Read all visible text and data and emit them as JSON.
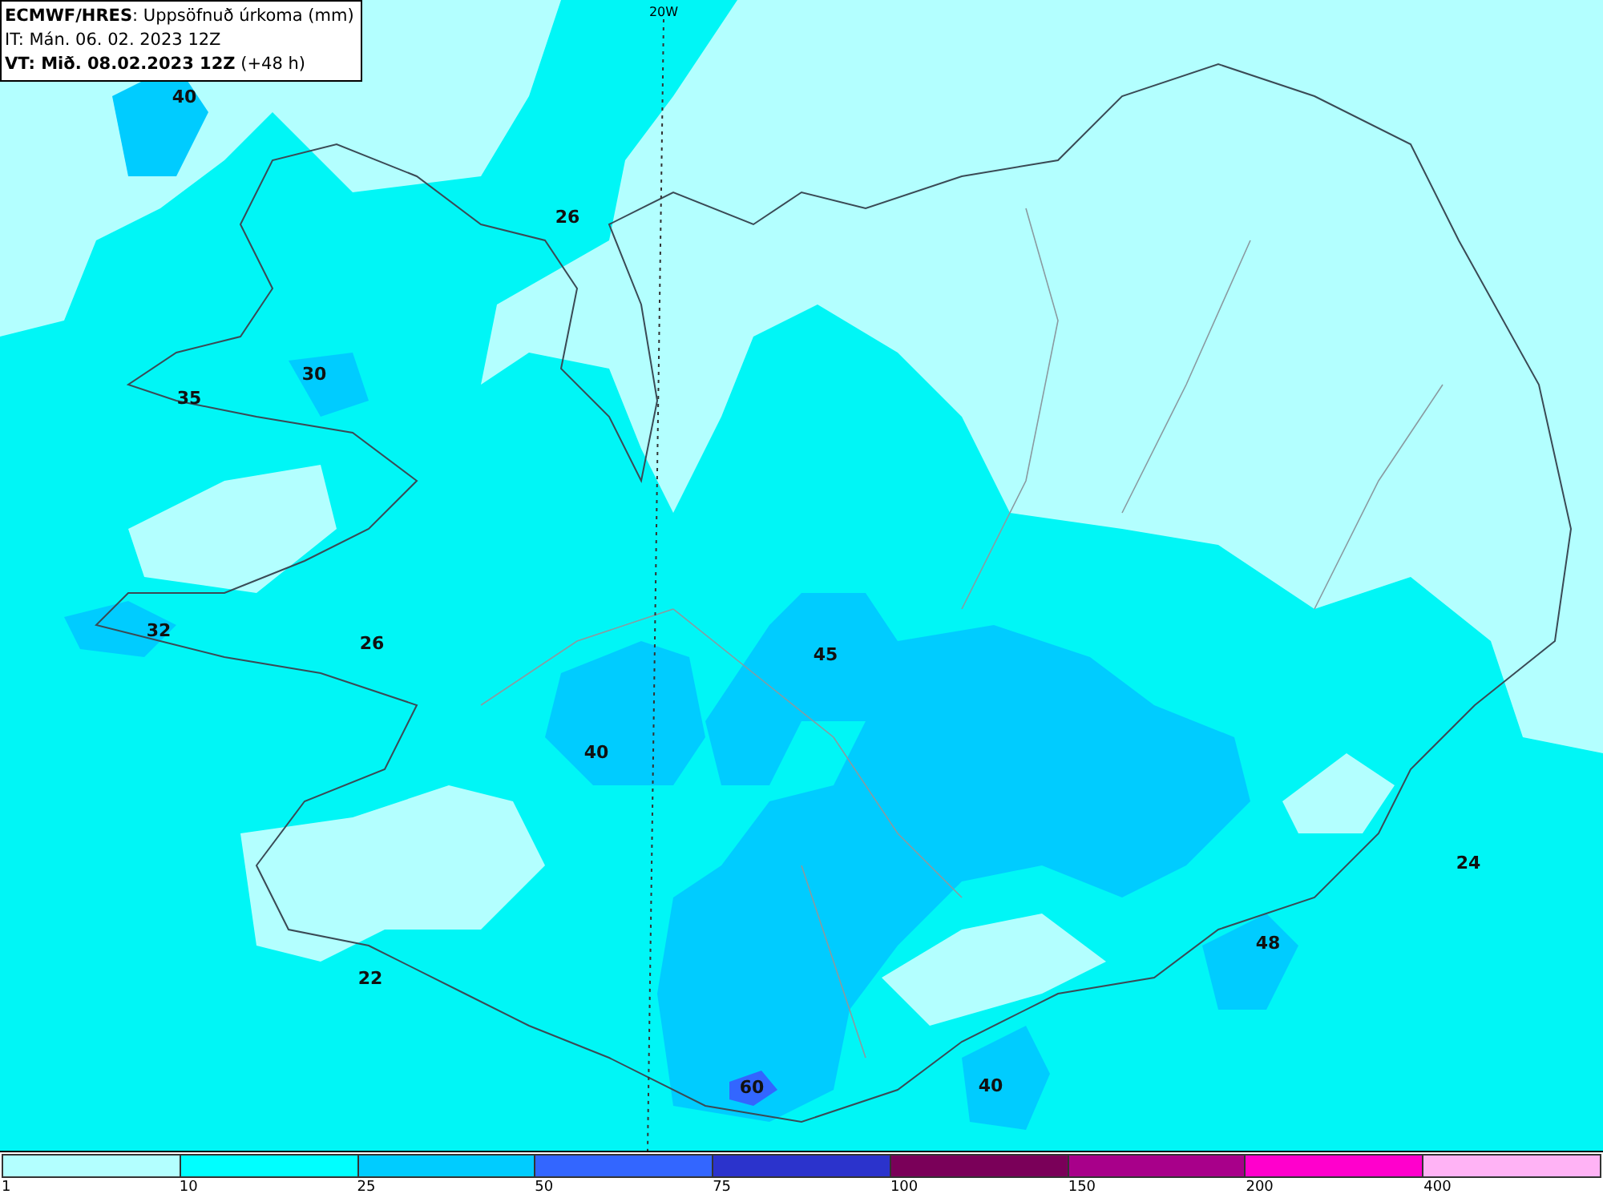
{
  "header": {
    "lines": [
      "**ECMWF/HRES**: Uppsöfnuð úrkoma (mm)",
      "IT: Mán. 06. 02. 2023 12Z",
      "**VT: Mið. 08.02.2023 12Z** (+48 h)"
    ]
  },
  "map": {
    "meridian_label": "20W",
    "values": [
      "40",
      "26",
      "35",
      "30",
      "32",
      "26",
      "45",
      "40",
      "24",
      "48",
      "22",
      "60",
      "40"
    ]
  },
  "legend": [
    {
      "label": "1",
      "color": "#b3ffff"
    },
    {
      "label": "10",
      "color": "#00ffff"
    },
    {
      "label": "25",
      "color": "#00ccff"
    },
    {
      "label": "50",
      "color": "#3366ff"
    },
    {
      "label": "75",
      "color": "#2b33cc"
    },
    {
      "label": "100",
      "color": "#7a0059"
    },
    {
      "label": "150",
      "color": "#a8008a"
    },
    {
      "label": "200",
      "color": "#ff00cc"
    },
    {
      "label": "400",
      "color": "#ffb3f5"
    }
  ]
}
